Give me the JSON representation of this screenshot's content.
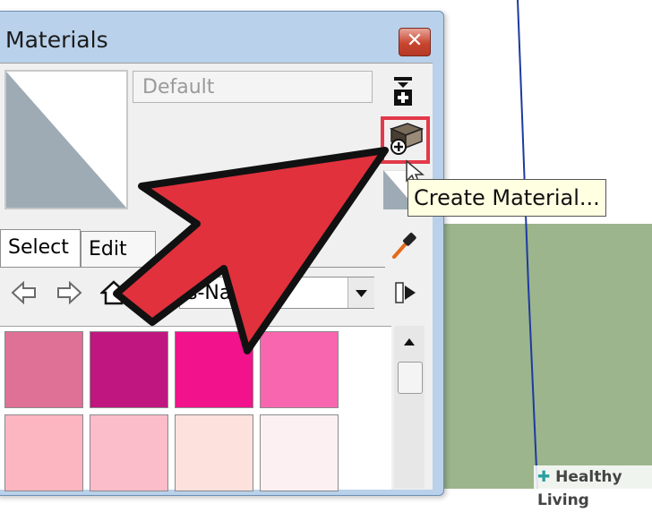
{
  "window": {
    "title": "Materials",
    "close_symbol": "✕"
  },
  "material": {
    "name": "Default"
  },
  "create_button": {
    "icon": "create-material-icon"
  },
  "tooltip": {
    "text": "Create Material..."
  },
  "tabs": [
    {
      "label": "Select"
    },
    {
      "label": "Edit"
    }
  ],
  "collection": {
    "visible_text": "s-Na"
  },
  "swatches": [
    [
      "#df7096",
      "#c0167f",
      "#f2128b",
      "#f766ae"
    ],
    [
      "#fbb6c1",
      "#fbbdca",
      "#fde1dd",
      "#fcf0f3"
    ]
  ],
  "watermark": {
    "text": "Healthy Living"
  },
  "colors": {
    "arrow": "#e0313d",
    "highlight": "#e23a4a",
    "ground": "#9cb58c",
    "axis": "#1d3aa0"
  }
}
